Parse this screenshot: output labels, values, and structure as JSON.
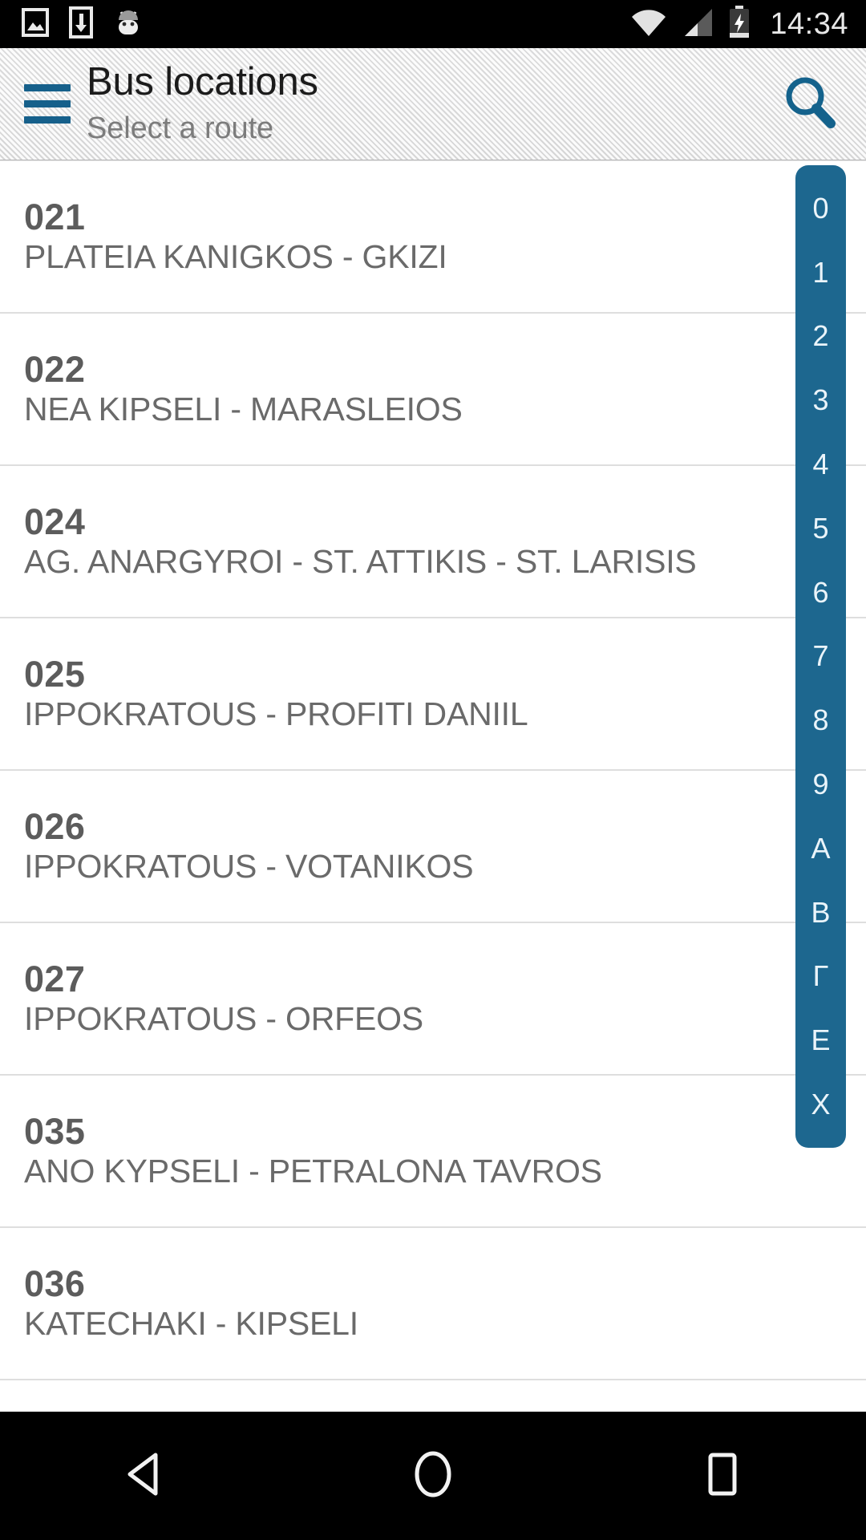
{
  "statusbar": {
    "time": "14:34",
    "left_icons": [
      "image-icon",
      "download-icon",
      "android-robot-icon"
    ],
    "right_icons": [
      "wifi-icon",
      "cellular-signal-icon",
      "battery-charging-icon"
    ]
  },
  "actionbar": {
    "title": "Bus locations",
    "subtitle": "Select a route",
    "drawer_icon": "hamburger-menu-icon",
    "search_icon": "search-icon",
    "accent_color": "#16608b",
    "background_color": "#e6e6e7",
    "title_color": "#1b1b1b",
    "subtitle_color": "#7c7c7c"
  },
  "list": {
    "rows": [
      {
        "code": "021",
        "name": "PLATEIA KANIGKOS - GKIZI"
      },
      {
        "code": "022",
        "name": "NEA KIPSELI - MARASLEIOS"
      },
      {
        "code": "024",
        "name": "AG. ANARGYROI - ST. ATTIKIS - ST. LARISIS"
      },
      {
        "code": "025",
        "name": "IPPOKRATOUS - PROFITI DANIIL"
      },
      {
        "code": "026",
        "name": "IPPOKRATOUS - VOTANIKOS"
      },
      {
        "code": "027",
        "name": "IPPOKRATOUS - ORFEOS"
      },
      {
        "code": "035",
        "name": "ANO KYPSELI - PETRALONA TAVROS"
      },
      {
        "code": "036",
        "name": "KATECHAKI - KIPSELI"
      }
    ],
    "code_color": "#5c5c5c",
    "name_color": "#6a6a6a",
    "divider_color": "#dedede"
  },
  "fastscroll": {
    "items": [
      "0",
      "1",
      "2",
      "3",
      "4",
      "5",
      "6",
      "7",
      "8",
      "9",
      "Α",
      "Β",
      "Γ",
      "Ε",
      "Χ"
    ],
    "background_color": "#1d678f",
    "text_color": "#eaf4fa"
  },
  "navbar": {
    "back_icon": "back-triangle-icon",
    "home_icon": "home-circle-icon",
    "recents_icon": "recents-square-icon"
  }
}
